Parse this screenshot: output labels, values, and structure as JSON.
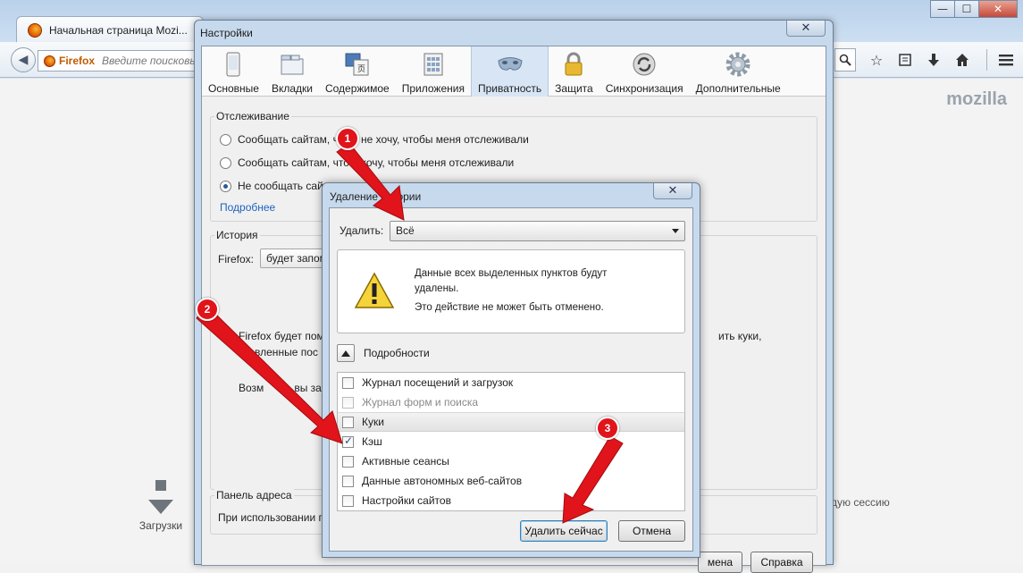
{
  "browser": {
    "tab_title": "Начальная страница Mozi...",
    "url_identity": "Firefox",
    "url_placeholder": "Введите поисковый",
    "brand_text": "mozilla",
    "downloads_label": "Загрузки",
    "session_text": "дую сессию",
    "window_controls": {
      "minimize": "—",
      "maximize": "☐",
      "close": "✕"
    }
  },
  "settings": {
    "title": "Настройки",
    "close": "✕",
    "panes": [
      {
        "label": "Основные",
        "icon": "general-icon"
      },
      {
        "label": "Вкладки",
        "icon": "tabs-icon"
      },
      {
        "label": "Содержимое",
        "icon": "content-icon"
      },
      {
        "label": "Приложения",
        "icon": "applications-icon"
      },
      {
        "label": "Приватность",
        "icon": "privacy-mask-icon",
        "active": true
      },
      {
        "label": "Защита",
        "icon": "lock-icon"
      },
      {
        "label": "Синхронизация",
        "icon": "sync-icon"
      },
      {
        "label": "Дополнительные",
        "icon": "gear-icon"
      }
    ],
    "tracking": {
      "label": "Отслеживание",
      "opt1": "Сообщать сайтам, что я не хочу, чтобы меня отслеживали",
      "opt1_visible": "Сообщать сайтам, что я не хочу, чтобы меня отслеживали",
      "opt2": "Сообщать сайтам, что я хочу, чтобы меня отслеживали",
      "opt3": "Не сообщать сайт",
      "more_link": "Подробнее"
    },
    "history": {
      "label": "История",
      "firefox_label": "Firefox:",
      "firefox_select": "будет запом",
      "text1": "Firefox будет пом",
      "text1_right": "ить куки,",
      "text2": "ставленные пос",
      "text3": "Возм",
      "text3b": "о, вы за"
    },
    "address_bar": {
      "label": "Панель адреса",
      "text": "При использовании п"
    },
    "buttons": {
      "ok_partial": "мена",
      "help": "Справка"
    }
  },
  "clear_dialog": {
    "title": "Удаление      истории",
    "close": "✕",
    "range_label": "Удалить:",
    "range_value": "Всё",
    "warning_line1": "Данные всех выделенных пунктов будут удалены.",
    "warning_line2": "Это действие не может быть отменено.",
    "details_label": "Подробности",
    "items": [
      {
        "label": "Журнал посещений и загрузок",
        "checked": false,
        "disabled": false
      },
      {
        "label": "Журнал форм и поиска",
        "checked": false,
        "disabled": true
      },
      {
        "label": "Куки",
        "checked": false,
        "disabled": false
      },
      {
        "label": "Кэш",
        "checked": true,
        "disabled": false
      },
      {
        "label": "Активные сеансы",
        "checked": false,
        "disabled": false
      },
      {
        "label": "Данные автономных веб-сайтов",
        "checked": false,
        "disabled": false
      },
      {
        "label": "Настройки сайтов",
        "checked": false,
        "disabled": false
      }
    ],
    "clear_now": "Удалить сейчас",
    "cancel": "Отмена"
  },
  "annotations": {
    "badges": [
      "1",
      "2",
      "3"
    ],
    "color": "#e0141a"
  }
}
